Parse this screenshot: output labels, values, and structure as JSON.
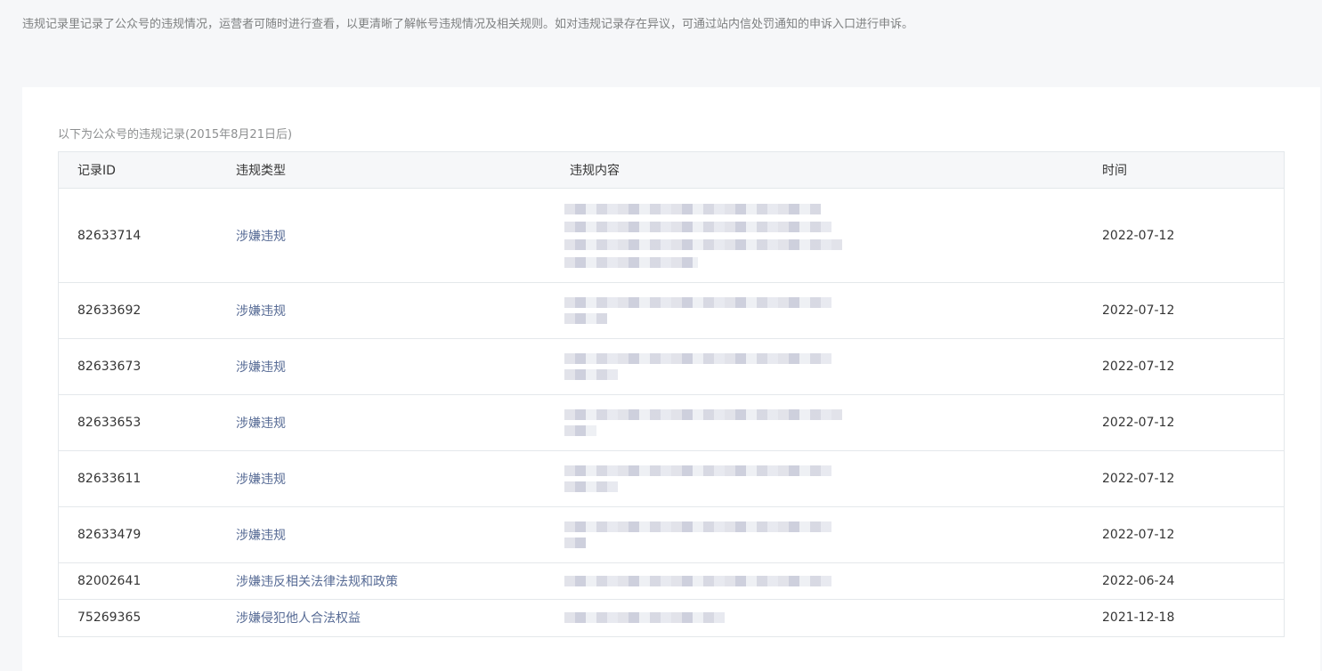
{
  "intro_text": "违规记录里记录了公众号的违规情况，运营者可随时进行查看，以更清晰了解帐号违规情况及相关规则。如对违规记录存在异议，可通过站内信处罚通知的申诉入口进行申诉。",
  "table_caption": "以下为公众号的违规记录(2015年8月21日后)",
  "columns": {
    "id": "记录ID",
    "type": "违规类型",
    "content": "违规内容",
    "time": "时间"
  },
  "rows": [
    {
      "id": "82633714",
      "type": "涉嫌违规",
      "time": "2022-07-12"
    },
    {
      "id": "82633692",
      "type": "涉嫌违规",
      "time": "2022-07-12"
    },
    {
      "id": "82633673",
      "type": "涉嫌违规",
      "time": "2022-07-12"
    },
    {
      "id": "82633653",
      "type": "涉嫌违规",
      "time": "2022-07-12"
    },
    {
      "id": "82633611",
      "type": "涉嫌违规",
      "time": "2022-07-12"
    },
    {
      "id": "82633479",
      "type": "涉嫌违规",
      "time": "2022-07-12"
    },
    {
      "id": "82002641",
      "type": "涉嫌违反相关法律法规和政策",
      "time": "2022-06-24"
    },
    {
      "id": "75269365",
      "type": "涉嫌侵犯他人合法权益",
      "time": "2021-12-18"
    }
  ],
  "colors": {
    "link": "#576b95",
    "page_bg": "#f6f7f9",
    "card_bg": "#ffffff",
    "border": "#e4e8eb"
  }
}
